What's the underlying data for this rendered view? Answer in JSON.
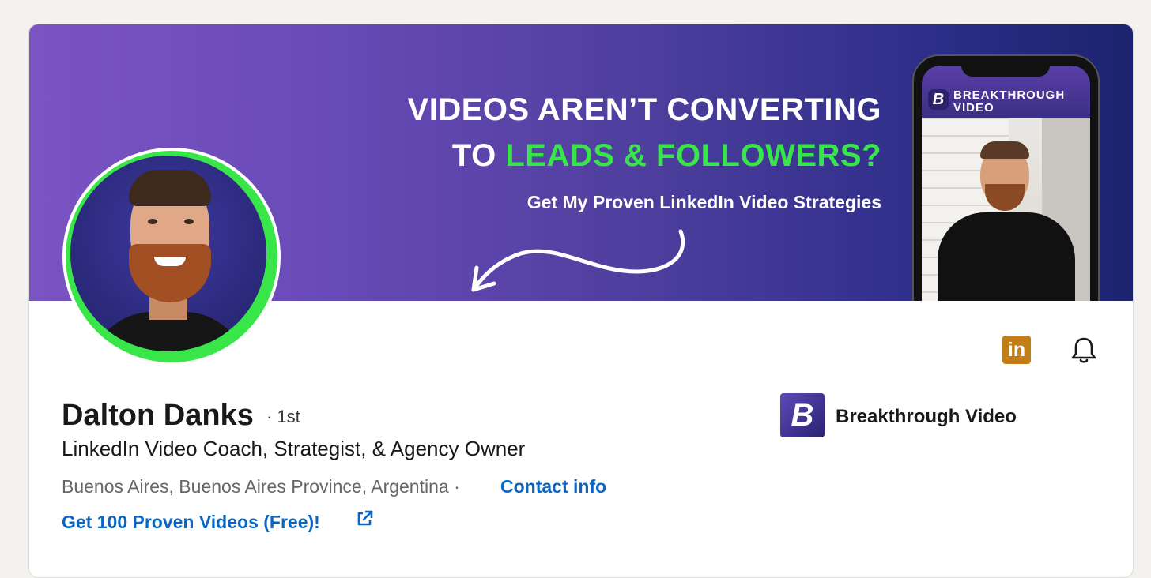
{
  "banner": {
    "headline_line1": "VIDEOS AREN’T CONVERTING",
    "headline_line2_prefix": "TO ",
    "headline_line2_highlight": "LEADS & FOLLOWERS?",
    "subtitle": "Get My Proven LinkedIn Video Strategies",
    "phone_logo_letter": "B",
    "phone_brand": "BREAKTHROUGH VIDEO"
  },
  "profile": {
    "name": "Dalton Danks",
    "degree": "· 1st",
    "headline": "LinkedIn Video Coach, Strategist, & Agency Owner",
    "location": "Buenos Aires, Buenos Aires Province, Argentina ·",
    "contact_label": "Contact info",
    "website_label": "Get 100 Proven Videos (Free)!"
  },
  "company": {
    "logo_letter": "B",
    "name": "Breakthrough Video"
  },
  "icons": {
    "linkedin": "linkedin-icon",
    "linkedin_text": "in",
    "bell": "bell-icon",
    "external_link": "external-link-icon"
  },
  "colors": {
    "accent_green": "#39e64a",
    "link_blue": "#0a66c2",
    "linkedin_badge": "#c37d16"
  }
}
